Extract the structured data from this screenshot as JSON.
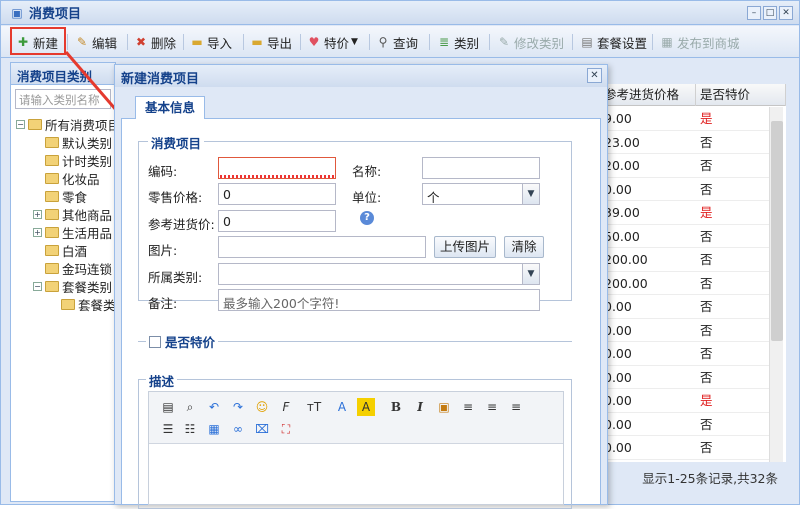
{
  "window": {
    "title": "消费项目"
  },
  "toolbar": {
    "new": "新建",
    "edit": "编辑",
    "delete": "删除",
    "import": "导入",
    "export": "导出",
    "special": "特价",
    "query": "查询",
    "category": "类别",
    "modify_category": "修改类别",
    "package_settings": "套餐设置",
    "publish": "发布到商城"
  },
  "left_panel": {
    "title": "消费项目类别",
    "search_placeholder": "请输入类别名称",
    "tree": [
      "所有消费项目",
      "默认类别",
      "计时类别",
      "化妆品",
      "零食",
      "其他商品",
      "生活用品",
      "白酒",
      "金玛连锁",
      "套餐类别",
      "套餐类"
    ]
  },
  "grid": {
    "headers": [
      "参考进货价格",
      "是否特价"
    ],
    "rows": [
      {
        "price": "9.00",
        "special": "是"
      },
      {
        "price": "23.00",
        "special": "否"
      },
      {
        "price": "20.00",
        "special": "否"
      },
      {
        "price": "0.00",
        "special": "否"
      },
      {
        "price": "39.00",
        "special": "是"
      },
      {
        "price": "50.00",
        "special": "否"
      },
      {
        "price": "200.00",
        "special": "否"
      },
      {
        "price": "200.00",
        "special": "否"
      },
      {
        "price": "0.00",
        "special": "否"
      },
      {
        "price": "0.00",
        "special": "否"
      },
      {
        "price": "0.00",
        "special": "否"
      },
      {
        "price": "0.00",
        "special": "否"
      },
      {
        "price": "0.00",
        "special": "是"
      },
      {
        "price": "0.00",
        "special": "否"
      },
      {
        "price": "0.00",
        "special": "否"
      }
    ],
    "footer": "显示1-25条记录,共32条"
  },
  "dialog": {
    "title": "新建消费项目",
    "tab": "基本信息",
    "section_items": "消费项目",
    "code_label": "编码:",
    "code_value": "",
    "name_label": "名称:",
    "name_value": "",
    "retail_label": "零售价格:",
    "retail_value": "0",
    "unit_label": "单位:",
    "unit_value": "个",
    "ref_label": "参考进货价:",
    "ref_value": "0",
    "image_label": "图片:",
    "upload": "上传图片",
    "clear": "清除",
    "category_label": "所属类别:",
    "category_value": "",
    "note_label": "备注:",
    "note_placeholder": "最多输入200个字符!",
    "special_section": "是否特价",
    "desc_section": "描述"
  },
  "colors": {
    "accent": "#15428b",
    "highlight": "#e53a2e",
    "error": "#e02020"
  }
}
